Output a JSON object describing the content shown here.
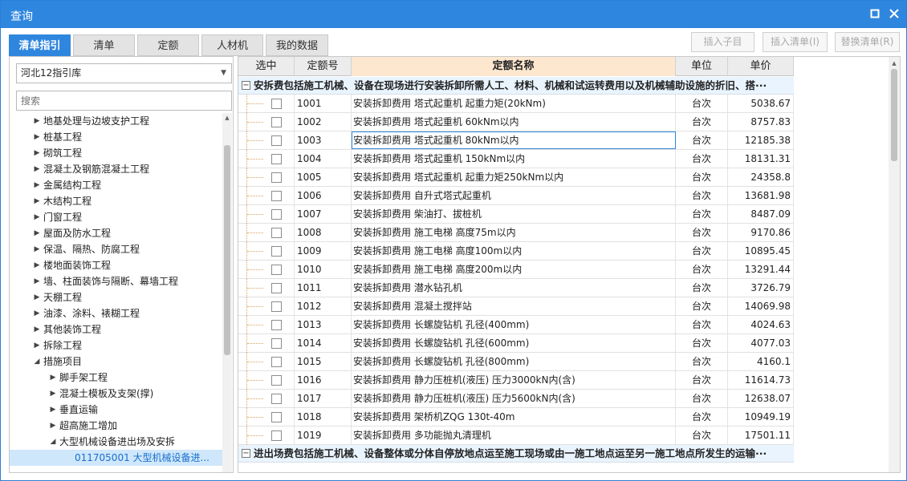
{
  "window": {
    "title": "查询",
    "restore_icon": "restore-icon",
    "close_icon": "close-icon"
  },
  "tabs": [
    "清单指引",
    "清单",
    "定额",
    "人材机",
    "我的数据"
  ],
  "toolbar": {
    "insert_child": "插入子目",
    "insert_list": "插入清单(I)",
    "replace_list": "替换清单(R)"
  },
  "library": {
    "selected": "河北12指引库"
  },
  "search": {
    "placeholder": "搜索"
  },
  "tree": [
    {
      "label": "地基处理与边坡支护工程",
      "level": 1,
      "state": "collapsed"
    },
    {
      "label": "桩基工程",
      "level": 1,
      "state": "collapsed"
    },
    {
      "label": "砌筑工程",
      "level": 1,
      "state": "collapsed"
    },
    {
      "label": "混凝土及钢筋混凝土工程",
      "level": 1,
      "state": "collapsed"
    },
    {
      "label": "金属结构工程",
      "level": 1,
      "state": "collapsed"
    },
    {
      "label": "木结构工程",
      "level": 1,
      "state": "collapsed"
    },
    {
      "label": "门窗工程",
      "level": 1,
      "state": "collapsed"
    },
    {
      "label": "屋面及防水工程",
      "level": 1,
      "state": "collapsed"
    },
    {
      "label": "保温、隔热、防腐工程",
      "level": 1,
      "state": "collapsed"
    },
    {
      "label": "楼地面装饰工程",
      "level": 1,
      "state": "collapsed"
    },
    {
      "label": "墙、柱面装饰与隔断、幕墙工程",
      "level": 1,
      "state": "collapsed"
    },
    {
      "label": "天棚工程",
      "level": 1,
      "state": "collapsed"
    },
    {
      "label": "油漆、涂料、裱糊工程",
      "level": 1,
      "state": "collapsed"
    },
    {
      "label": "其他装饰工程",
      "level": 1,
      "state": "collapsed"
    },
    {
      "label": "拆除工程",
      "level": 1,
      "state": "collapsed"
    },
    {
      "label": "措施项目",
      "level": 1,
      "state": "expanded"
    },
    {
      "label": "脚手架工程",
      "level": 2,
      "state": "collapsed"
    },
    {
      "label": "混凝土模板及支架(撑)",
      "level": 2,
      "state": "collapsed"
    },
    {
      "label": "垂直运输",
      "level": 2,
      "state": "collapsed"
    },
    {
      "label": "超高施工增加",
      "level": 2,
      "state": "collapsed"
    },
    {
      "label": "大型机械设备进出场及安拆",
      "level": 2,
      "state": "expanded"
    },
    {
      "label": "011705001   大型机械设备进...",
      "level": 3,
      "state": "leaf",
      "selected": true
    }
  ],
  "grid": {
    "headers": [
      "选中",
      "定额号",
      "定额名称",
      "单位",
      "单价"
    ],
    "groups": [
      {
        "title": "安拆费包括施工机械、设备在现场进行安装拆卸所需人工、材料、机械和试运转费用以及机械辅助设施的折旧、搭···"
      },
      {
        "title": "进出场费包括施工机械、设备整体或分体自停放地点运至施工现场或由一施工地点运至另一施工地点所发生的运输···"
      }
    ],
    "rows": [
      {
        "code": "1001",
        "name": "安装拆卸费用 塔式起重机 起重力矩(20kNm)",
        "unit": "台次",
        "price": "5038.67"
      },
      {
        "code": "1002",
        "name": "安装拆卸费用 塔式起重机 60kNm以内",
        "unit": "台次",
        "price": "8757.83"
      },
      {
        "code": "1003",
        "name": "安装拆卸费用 塔式起重机 80kNm以内",
        "unit": "台次",
        "price": "12185.38"
      },
      {
        "code": "1004",
        "name": "安装拆卸费用 塔式起重机 150kNm以内",
        "unit": "台次",
        "price": "18131.31"
      },
      {
        "code": "1005",
        "name": "安装拆卸费用 塔式起重机 起重力矩250kNm以内",
        "unit": "台次",
        "price": "24358.8"
      },
      {
        "code": "1006",
        "name": "安装拆卸费用 自升式塔式起重机",
        "unit": "台次",
        "price": "13681.98"
      },
      {
        "code": "1007",
        "name": "安装拆卸费用 柴油打、拔桩机",
        "unit": "台次",
        "price": "8487.09"
      },
      {
        "code": "1008",
        "name": "安装拆卸费用 施工电梯 高度75m以内",
        "unit": "台次",
        "price": "9170.86"
      },
      {
        "code": "1009",
        "name": "安装拆卸费用 施工电梯 高度100m以内",
        "unit": "台次",
        "price": "10895.45"
      },
      {
        "code": "1010",
        "name": "安装拆卸费用 施工电梯 高度200m以内",
        "unit": "台次",
        "price": "13291.44"
      },
      {
        "code": "1011",
        "name": "安装拆卸费用 潜水钻孔机",
        "unit": "台次",
        "price": "3726.79"
      },
      {
        "code": "1012",
        "name": "安装拆卸费用 混凝土搅拌站",
        "unit": "台次",
        "price": "14069.98"
      },
      {
        "code": "1013",
        "name": "安装拆卸费用 长螺旋钻机 孔径(400mm)",
        "unit": "台次",
        "price": "4024.63"
      },
      {
        "code": "1014",
        "name": "安装拆卸费用 长螺旋钻机 孔径(600mm)",
        "unit": "台次",
        "price": "4077.03"
      },
      {
        "code": "1015",
        "name": "安装拆卸费用 长螺旋钻机 孔径(800mm)",
        "unit": "台次",
        "price": "4160.1"
      },
      {
        "code": "1016",
        "name": "安装拆卸费用 静力压桩机(液压) 压力3000kN内(含)",
        "unit": "台次",
        "price": "11614.73"
      },
      {
        "code": "1017",
        "name": "安装拆卸费用 静力压桩机(液压) 压力5600kN内(含)",
        "unit": "台次",
        "price": "12638.07"
      },
      {
        "code": "1018",
        "name": "安装拆卸费用 架桥机ZQG 130t-40m",
        "unit": "台次",
        "price": "10949.19"
      },
      {
        "code": "1019",
        "name": "安装拆卸费用 多功能抛丸清理机",
        "unit": "台次",
        "price": "17501.11"
      }
    ],
    "focused_row": "1003"
  },
  "colors": {
    "accent": "#2f86df",
    "header_highlight": "#fde7cf",
    "group_bg": "#e9f4ff",
    "selected_tree": "#cfe7fb"
  }
}
